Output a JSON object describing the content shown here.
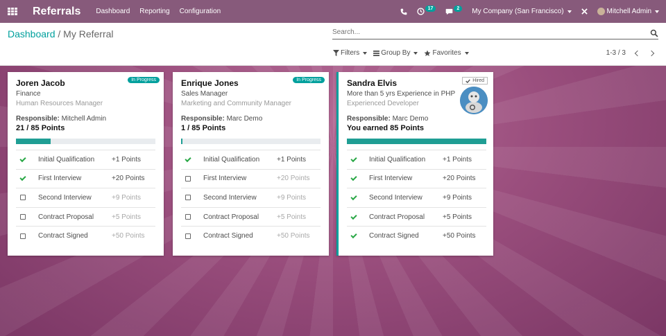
{
  "navbar": {
    "app_title": "Referrals",
    "menu": [
      "Dashboard",
      "Reporting",
      "Configuration"
    ],
    "activity_badge": "17",
    "messages_badge": "2",
    "company": "My Company (San Francisco)",
    "user": "Mitchell Admin"
  },
  "breadcrumb": {
    "parent": "Dashboard",
    "separator": "/",
    "current": "My Referral"
  },
  "search": {
    "placeholder": "Search..."
  },
  "filters": {
    "filters_label": "Filters",
    "group_by_label": "Group By",
    "favorites_label": "Favorites"
  },
  "pager": {
    "text": "1-3 / 3"
  },
  "responsible_label": "Responsible:",
  "colors": {
    "primary": "#875a7b",
    "accent": "#00a09d",
    "check": "#28a745",
    "progress": "#1f9e94"
  },
  "cards": [
    {
      "name": "Joren Jacob",
      "line1": "Finance",
      "line2": "Human Resources Manager",
      "responsible": "Mitchell Admin",
      "points_text": "21 / 85 Points",
      "status": "In Progress",
      "hired": false,
      "progress_fraction": 0.247,
      "stages": [
        {
          "label": "Initial Qualification",
          "points": "+1 Points",
          "done": true
        },
        {
          "label": "First Interview",
          "points": "+20 Points",
          "done": true
        },
        {
          "label": "Second Interview",
          "points": "+9 Points",
          "done": false
        },
        {
          "label": "Contract Proposal",
          "points": "+5 Points",
          "done": false
        },
        {
          "label": "Contract Signed",
          "points": "+50 Points",
          "done": false
        }
      ]
    },
    {
      "name": "Enrique Jones",
      "line1": "Sales Manager",
      "line2": "Marketing and Community Manager",
      "responsible": "Marc Demo",
      "points_text": "1 / 85 Points",
      "status": "In Progress",
      "hired": false,
      "progress_fraction": 0.012,
      "stages": [
        {
          "label": "Initial Qualification",
          "points": "+1 Points",
          "done": true
        },
        {
          "label": "First Interview",
          "points": "+20 Points",
          "done": false
        },
        {
          "label": "Second Interview",
          "points": "+9 Points",
          "done": false
        },
        {
          "label": "Contract Proposal",
          "points": "+5 Points",
          "done": false
        },
        {
          "label": "Contract Signed",
          "points": "+50 Points",
          "done": false
        }
      ]
    },
    {
      "name": "Sandra Elvis",
      "line1": "More than 5 yrs Experience in PHP",
      "line2": "Experienced Developer",
      "responsible": "Marc Demo",
      "points_text": "You earned 85 Points",
      "status": "Hired",
      "hired": true,
      "progress_fraction": 1.0,
      "stages": [
        {
          "label": "Initial Qualification",
          "points": "+1 Points",
          "done": true
        },
        {
          "label": "First Interview",
          "points": "+20 Points",
          "done": true
        },
        {
          "label": "Second Interview",
          "points": "+9 Points",
          "done": true
        },
        {
          "label": "Contract Proposal",
          "points": "+5 Points",
          "done": true
        },
        {
          "label": "Contract Signed",
          "points": "+50 Points",
          "done": true
        }
      ]
    }
  ]
}
